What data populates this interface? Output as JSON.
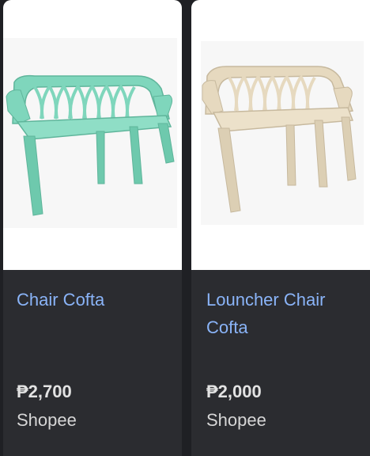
{
  "products": [
    {
      "title": "Chair Cofta",
      "price": "₱2,700",
      "seller": "Shopee",
      "image_icon": "green-plastic-bench-image",
      "color": "#7fd6bc"
    },
    {
      "title": "Louncher Chair Cofta",
      "price": "₱2,000",
      "seller": "Shopee",
      "image_icon": "beige-plastic-bench-image",
      "color": "#e6d9bf"
    }
  ]
}
